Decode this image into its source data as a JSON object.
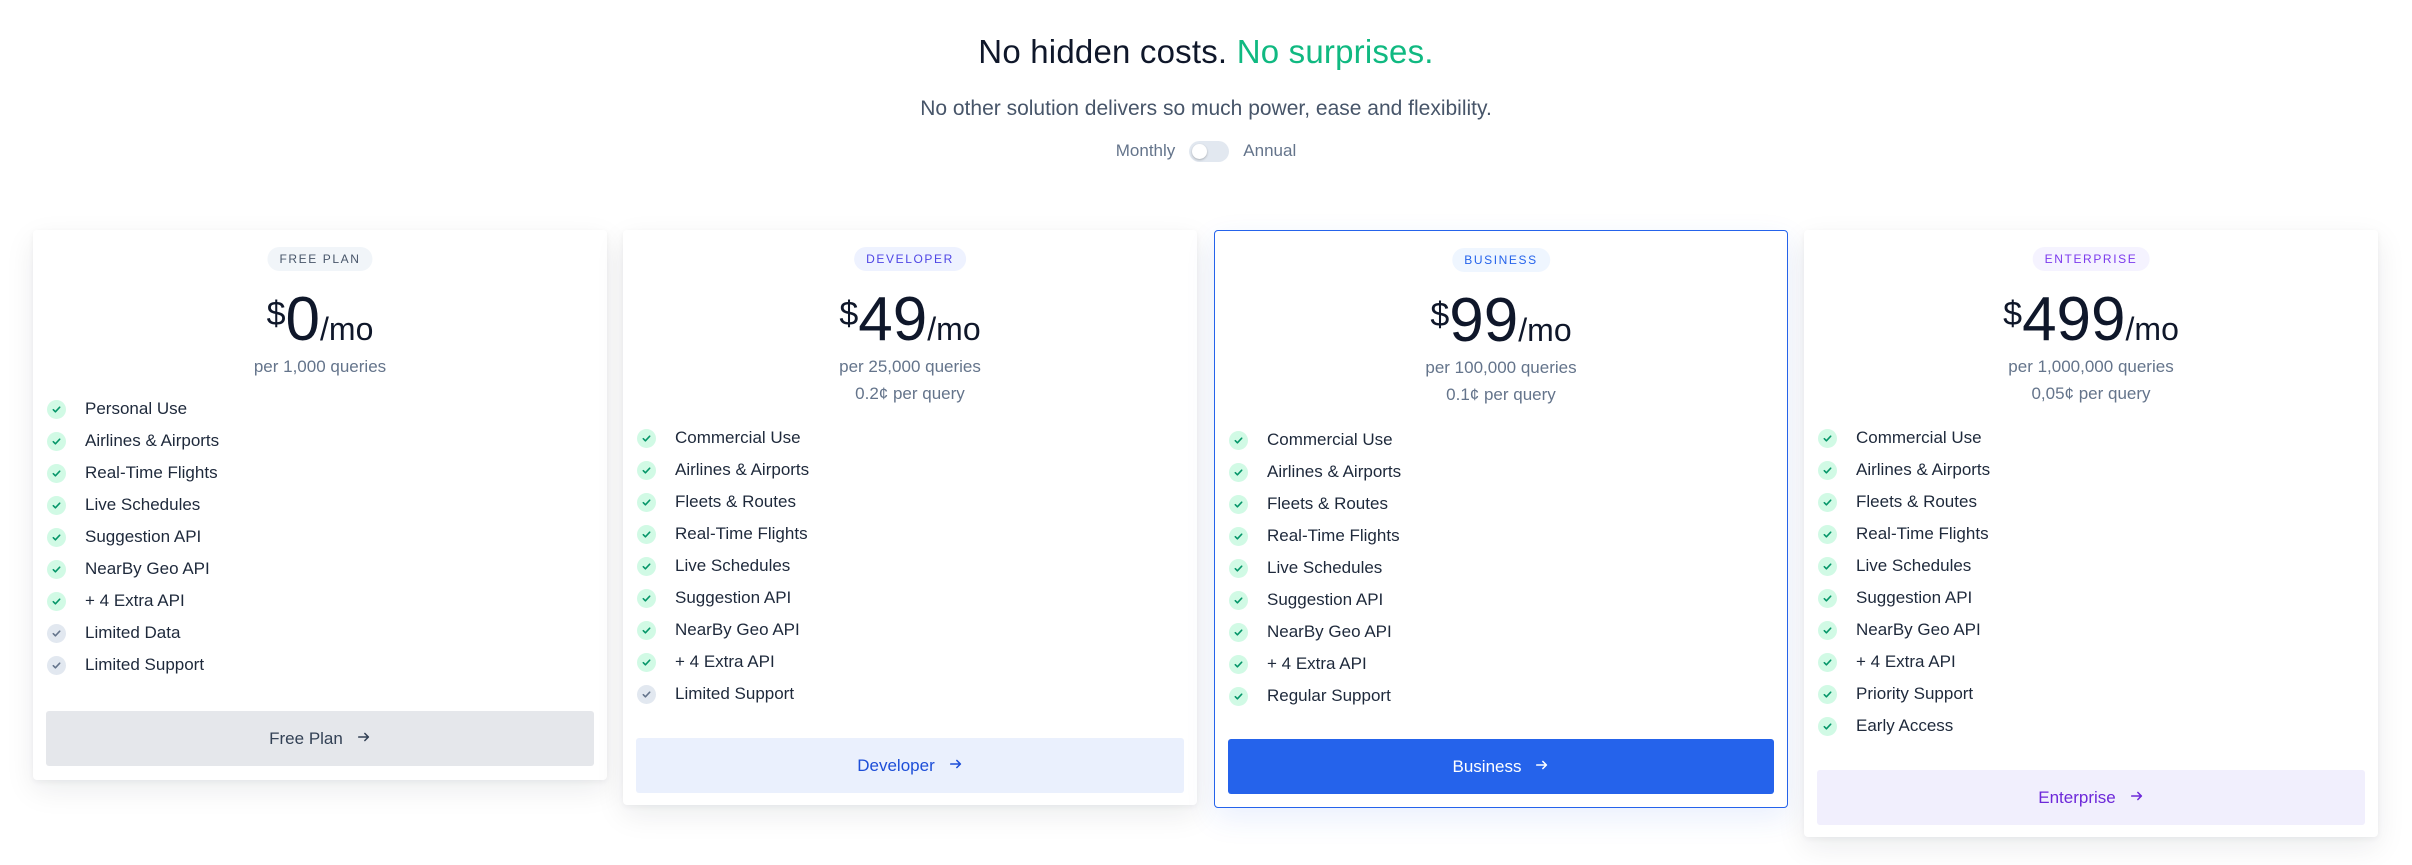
{
  "header": {
    "headline_main": "No hidden costs.",
    "headline_accent": "No surprises.",
    "subheadline": "No other solution delivers so much power, ease and flexibility.",
    "billing": {
      "monthly": "Monthly",
      "annual": "Annual",
      "annual_selected": false
    }
  },
  "colors": {
    "accent_green": "#10b981",
    "primary_blue": "#2563eb",
    "enterprise_purple": "#7c3aed"
  },
  "plans": [
    {
      "badge": "FREE PLAN",
      "currency": "$",
      "amount": "0",
      "period": "/mo",
      "queries": "per 1,000 queries",
      "features": [
        {
          "label": "Personal Use",
          "icon": "check-icon"
        },
        {
          "label": "Airlines & Airports",
          "icon": "check-icon"
        },
        {
          "label": "Real-Time Flights",
          "icon": "check-icon"
        },
        {
          "label": "Live Schedules",
          "icon": "check-icon"
        },
        {
          "label": "Suggestion API",
          "icon": "check-icon"
        },
        {
          "label": "NearBy Geo API",
          "icon": "check-icon"
        },
        {
          "label": "+ 4 Extra API",
          "icon": "check-icon"
        },
        {
          "label": "Limited Data",
          "icon": "check-muted-icon"
        },
        {
          "label": "Limited Support",
          "icon": "check-muted-icon"
        }
      ],
      "cta": "Free Plan"
    },
    {
      "badge": "DEVELOPER",
      "currency": "$",
      "amount": "49",
      "period": "/mo",
      "queries": "per 25,000 queries",
      "per_query": "0.2¢ per query",
      "features": [
        {
          "label": "Commercial Use",
          "icon": "check-icon"
        },
        {
          "label": "Airlines & Airports",
          "icon": "check-icon"
        },
        {
          "label": "Fleets & Routes",
          "icon": "check-icon"
        },
        {
          "label": "Real-Time Flights",
          "icon": "check-icon"
        },
        {
          "label": "Live Schedules",
          "icon": "check-icon"
        },
        {
          "label": "Suggestion API",
          "icon": "check-icon"
        },
        {
          "label": "NearBy Geo API",
          "icon": "check-icon"
        },
        {
          "label": "+ 4 Extra API",
          "icon": "check-icon"
        },
        {
          "label": "Limited Support",
          "icon": "check-muted-icon"
        }
      ],
      "cta": "Developer"
    },
    {
      "badge": "BUSINESS",
      "currency": "$",
      "amount": "99",
      "period": "/mo",
      "queries": "per 100,000 queries",
      "per_query": "0.1¢ per query",
      "features": [
        {
          "label": "Commercial Use",
          "icon": "check-icon"
        },
        {
          "label": "Airlines & Airports",
          "icon": "check-icon"
        },
        {
          "label": "Fleets & Routes",
          "icon": "check-icon"
        },
        {
          "label": "Real-Time Flights",
          "icon": "check-icon"
        },
        {
          "label": "Live Schedules",
          "icon": "check-icon"
        },
        {
          "label": "Suggestion API",
          "icon": "check-icon"
        },
        {
          "label": "NearBy Geo API",
          "icon": "check-icon"
        },
        {
          "label": "+ 4 Extra API",
          "icon": "check-icon"
        },
        {
          "label": "Regular Support",
          "icon": "check-icon"
        }
      ],
      "cta": "Business"
    },
    {
      "badge": "ENTERPRISE",
      "currency": "$",
      "amount": "499",
      "period": "/mo",
      "queries": "per 1,000,000 queries",
      "per_query": "0,05¢ per query",
      "features": [
        {
          "label": "Commercial Use",
          "icon": "check-icon"
        },
        {
          "label": "Airlines & Airports",
          "icon": "check-icon"
        },
        {
          "label": "Fleets & Routes",
          "icon": "check-icon"
        },
        {
          "label": "Real-Time Flights",
          "icon": "check-icon"
        },
        {
          "label": "Live Schedules",
          "icon": "check-icon"
        },
        {
          "label": "Suggestion API",
          "icon": "check-icon"
        },
        {
          "label": "NearBy Geo API",
          "icon": "check-icon"
        },
        {
          "label": "+ 4 Extra API",
          "icon": "check-icon"
        },
        {
          "label": "Priority Support",
          "icon": "check-icon"
        },
        {
          "label": "Early Access",
          "icon": "check-icon"
        }
      ],
      "cta": "Enterprise"
    }
  ]
}
